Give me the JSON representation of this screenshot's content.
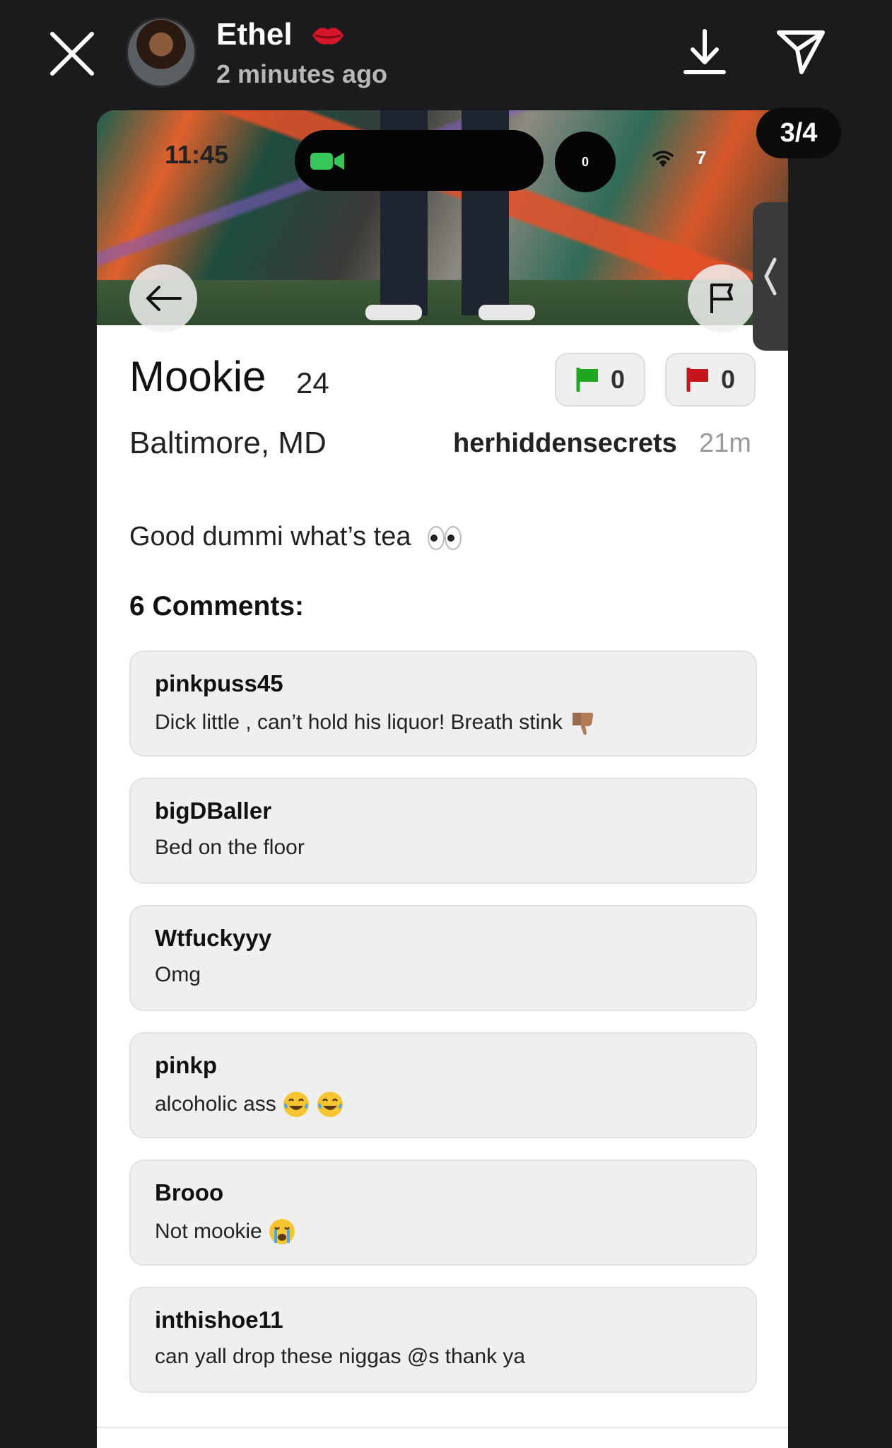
{
  "story": {
    "user_name": "Ethel",
    "time_ago": "2 minutes ago",
    "page_counter": "3/4"
  },
  "status_bar": {
    "time": "11:45",
    "island_count": "0",
    "battery": "7"
  },
  "profile": {
    "name": "Mookie",
    "age": "24",
    "location": "Baltimore, MD",
    "green_flags": "0",
    "red_flags": "0",
    "poster": "herhiddensecrets",
    "post_age": "21m",
    "post_text": "Good dummi what’s tea"
  },
  "comments_heading": "6 Comments:",
  "comments": [
    {
      "user": "pinkpuss45",
      "text": "Dick little , can’t hold his liquor! Breath stink",
      "emoji": "thumbs-down"
    },
    {
      "user": "bigDBaller",
      "text": "Bed on the floor",
      "emoji": ""
    },
    {
      "user": "Wtfuckyyy",
      "text": "Omg",
      "emoji": ""
    },
    {
      "user": "pinkp",
      "text": "alcoholic ass",
      "emoji": "tears-of-joy x2"
    },
    {
      "user": "Brooo",
      "text": "Not mookie",
      "emoji": "crying"
    },
    {
      "user": "inthishoe11",
      "text": "can yall drop these niggas @s thank ya",
      "emoji": ""
    }
  ],
  "colors": {
    "green_flag": "#1fa81f",
    "red_flag": "#c4161c",
    "facetime": "#35c759"
  }
}
